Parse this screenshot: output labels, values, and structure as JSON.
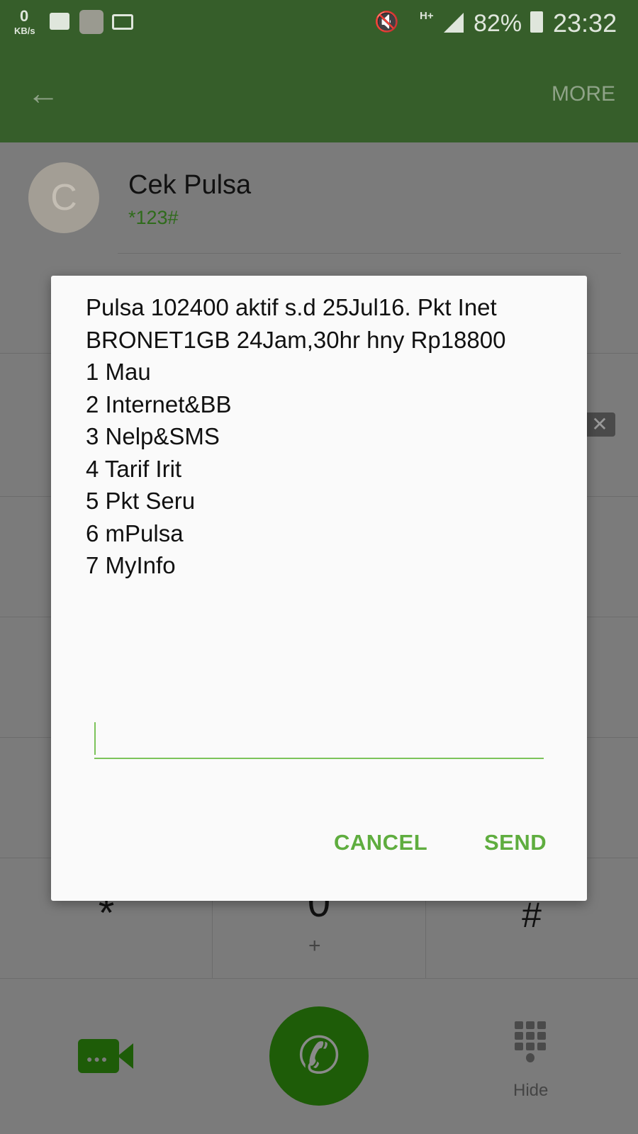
{
  "status_bar": {
    "net_speed": "0",
    "net_unit": "KB/s",
    "network": "H+",
    "battery": "82%",
    "time": "23:32"
  },
  "app_bar": {
    "more_label": "MORE"
  },
  "contact": {
    "initial": "C",
    "name": "Cek Pulsa",
    "number": "*123#"
  },
  "dialog": {
    "message": "Pulsa 102400 aktif s.d 25Jul16. Pkt Inet BRONET1GB 24Jam,30hr hny Rp18800",
    "options": [
      "1 Mau",
      "2 Internet&BB",
      "3 Nelp&SMS",
      "4 Tarif Irit",
      "5 Pkt Seru",
      "6 mPulsa",
      "7 MyInfo"
    ],
    "input_value": "",
    "cancel_label": "CANCEL",
    "send_label": "SEND"
  },
  "keypad": {
    "star": "*",
    "zero": "0",
    "zero_sub": "+",
    "hash": "#"
  },
  "bottom": {
    "hide_label": "Hide"
  },
  "colors": {
    "accent": "#5fad3f",
    "call_button": "#1e5c08",
    "app_bar": "#365e2a"
  }
}
